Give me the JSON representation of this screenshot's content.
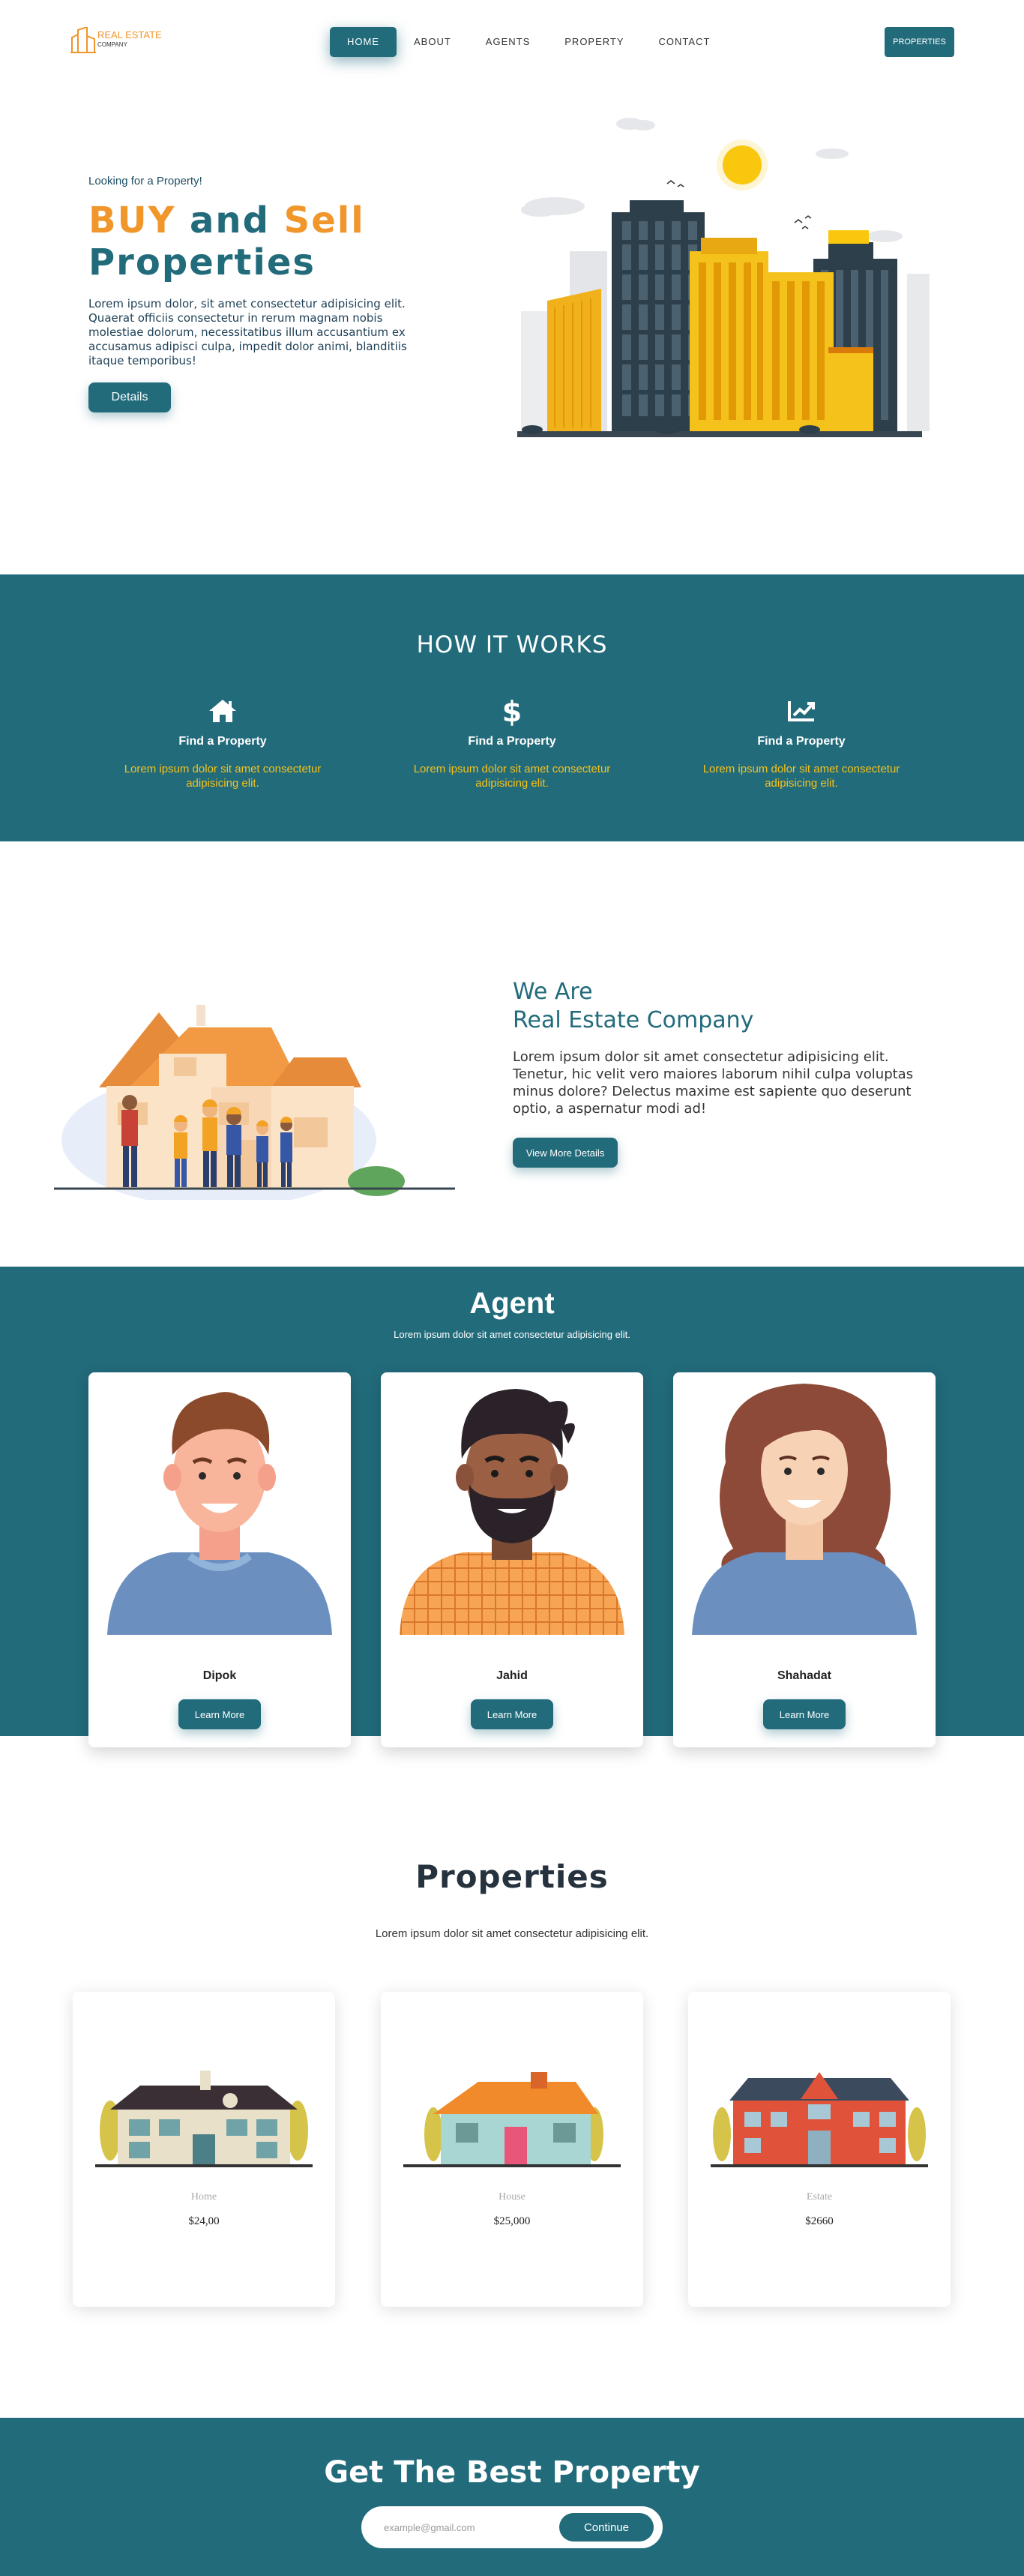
{
  "nav": {
    "logo_title": "REAL ESTATE",
    "logo_sub": "COMPANY",
    "items": [
      "HOME",
      "ABOUT",
      "AGENTS",
      "PROPERTY",
      "CONTACT"
    ],
    "cta": "PROPERTIES"
  },
  "hero": {
    "subtitle": "Looking for a Property!",
    "title_1": "BUY",
    "title_2": " and ",
    "title_3": "Sell",
    "title_4": "Properties",
    "body": "Lorem ipsum dolor, sit amet consectetur adipisicing elit. Quaerat officiis consectetur in rerum magnam nobis molestiae dolorum, necessitatibus illum accusantium ex accusamus adipisci culpa, impedit dolor animi, blanditiis itaque temporibus!",
    "button": "Details"
  },
  "how": {
    "title": "HOW IT WORKS",
    "items": [
      {
        "icon": "home-icon",
        "title": "Find a Property",
        "text": "Lorem ipsum dolor sit amet consectetur adipisicing elit."
      },
      {
        "icon": "dollar-icon",
        "title": "Find a Property",
        "text": "Lorem ipsum dolor sit amet consectetur adipisicing elit."
      },
      {
        "icon": "chart-icon",
        "title": "Find a Property",
        "text": "Lorem ipsum dolor sit amet consectetur adipisicing elit."
      }
    ]
  },
  "about": {
    "title_1": "We Are",
    "title_2": "Real Estate Company",
    "body": "Lorem ipsum dolor sit amet consectetur adipisicing elit. Tenetur, hic velit vero maiores laborum nihil culpa voluptas minus dolore? Delectus maxime est sapiente quo deserunt optio, a aspernatur modi ad!",
    "button": "View More Details"
  },
  "agents": {
    "title": "Agent",
    "subtitle": "Lorem ipsum dolor sit amet consectetur adipisicing elit.",
    "items": [
      {
        "name": "Dipok",
        "button": "Learn More"
      },
      {
        "name": "Jahid",
        "button": "Learn More"
      },
      {
        "name": "Shahadat",
        "button": "Learn More"
      }
    ]
  },
  "properties": {
    "title": "Properties",
    "subtitle": "Lorem ipsum dolor sit amet consectetur adipisicing elit.",
    "items": [
      {
        "type": "Home",
        "price": "$24,00"
      },
      {
        "type": "House",
        "price": "$25,000"
      },
      {
        "type": "Estate",
        "price": "$2660"
      }
    ]
  },
  "footer": {
    "title": "Get The Best Property",
    "email_placeholder": "example@gmail.com",
    "button": "Continue"
  },
  "colors": {
    "teal": "#226b7b",
    "orange": "#f0962b",
    "yellow": "#f5c21b"
  }
}
